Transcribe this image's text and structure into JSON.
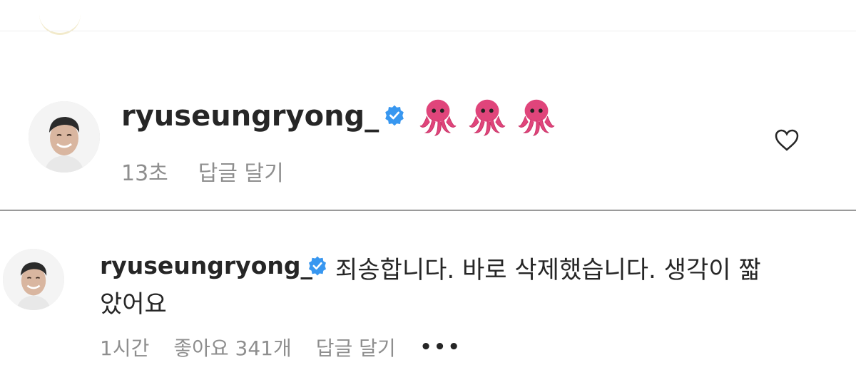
{
  "colors": {
    "verified_badge": "#3897f0",
    "octopus": "#e0457b",
    "meta_text": "#8e8e8e",
    "primary_text": "#262626"
  },
  "comments": [
    {
      "username": "ryuseungryong_",
      "verified": true,
      "emojis": [
        "octopus-emoji",
        "octopus-emoji",
        "octopus-emoji"
      ],
      "time": "13초",
      "reply_label": "답글 달기",
      "like_icon": "heart-outline-icon"
    },
    {
      "username": "ryuseungryong_",
      "verified": true,
      "text_line1": "죄송합니다. 바로 삭제했습니다. 생각이 짧",
      "text_line2": "았어요",
      "time": "1시간",
      "likes_label": "좋아요 341개",
      "reply_label": "답글 달기",
      "more_label": "•••"
    }
  ]
}
